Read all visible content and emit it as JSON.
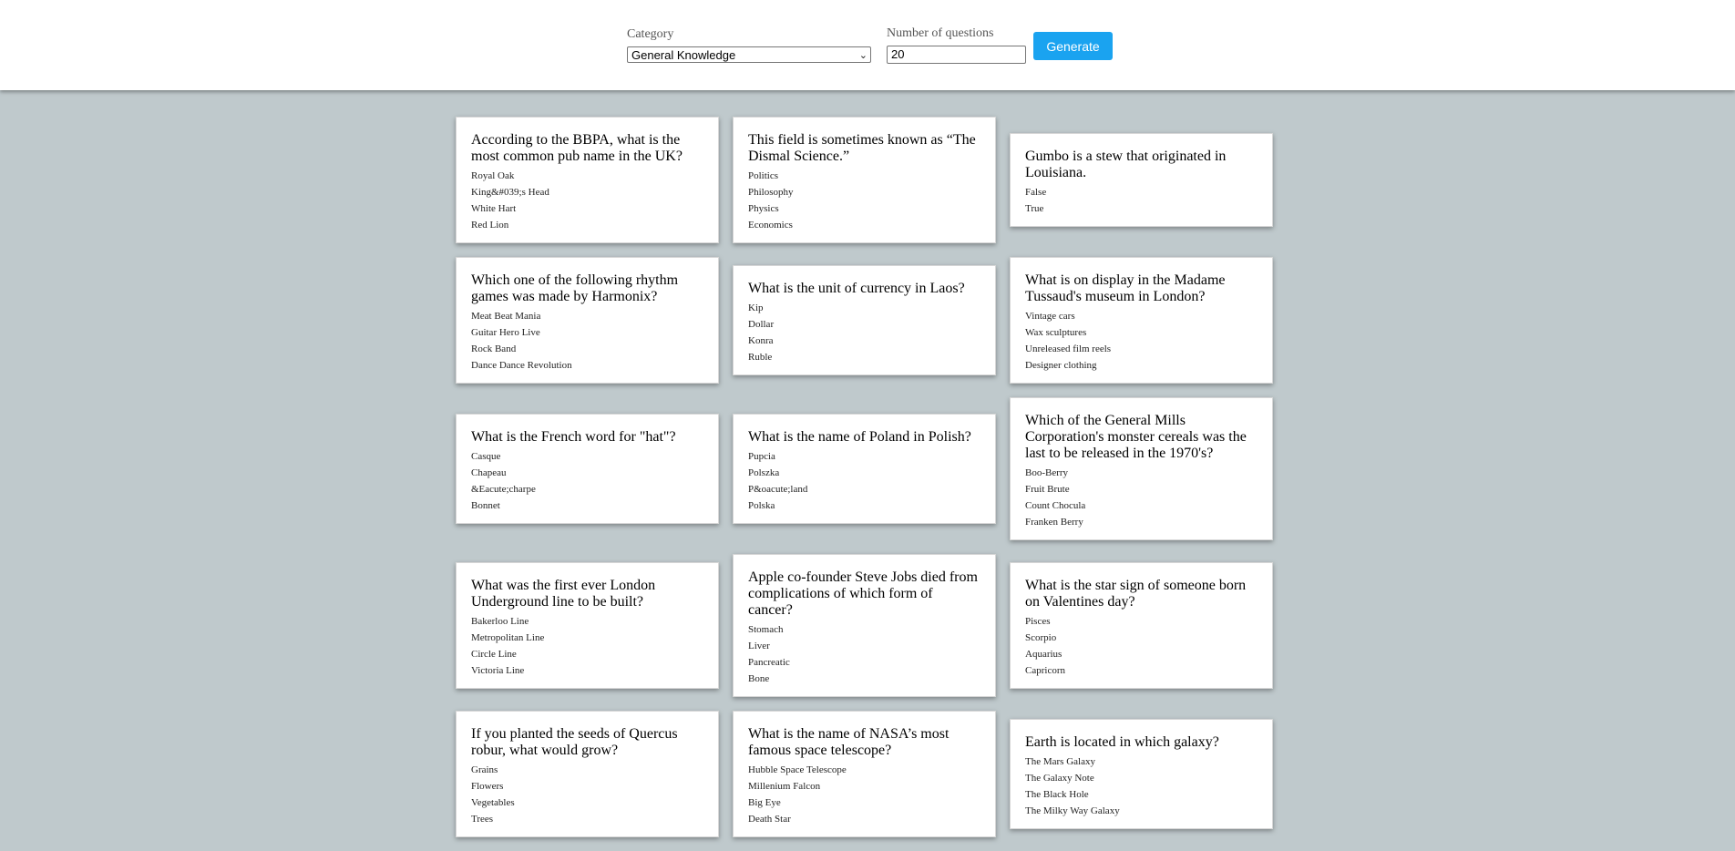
{
  "form": {
    "category_label": "Category",
    "category_value": "General Knowledge",
    "count_label": "Number of questions",
    "count_value": "20",
    "generate_label": "Generate"
  },
  "rows": [
    [
      {
        "question": "According to the BBPA, what is the most common pub name in the UK?",
        "answers": [
          "Royal Oak",
          "King&#039;s Head",
          "White Hart",
          "Red Lion"
        ]
      },
      {
        "question": "This field is sometimes known as “The Dismal Science.”",
        "answers": [
          "Politics",
          "Philosophy",
          "Physics",
          "Economics"
        ]
      },
      {
        "question": "Gumbo is a stew that originated in Louisiana.",
        "answers": [
          "False",
          "True"
        ]
      }
    ],
    [
      {
        "question": "Which one of the following rhythm games was made by Harmonix?",
        "answers": [
          "Meat Beat Mania",
          "Guitar Hero Live",
          "Rock Band",
          "Dance Dance Revolution"
        ]
      },
      {
        "question": "What is the unit of currency in Laos?",
        "answers": [
          "Kip",
          "Dollar",
          "Konra",
          "Ruble"
        ]
      },
      {
        "question": "What is on display in the Madame Tussaud's museum in London?",
        "answers": [
          "Vintage cars",
          "Wax sculptures",
          "Unreleased film reels",
          "Designer clothing"
        ]
      }
    ],
    [
      {
        "question": "What is the French word for \"hat\"?",
        "answers": [
          "Casque",
          "Chapeau",
          "&Eacute;charpe",
          "Bonnet"
        ]
      },
      {
        "question": "What is the name of Poland in Polish?",
        "answers": [
          "Pupcia",
          "Polszka",
          "P&oacute;land",
          "Polska"
        ]
      },
      {
        "question": "Which of the General Mills Corporation's monster cereals was the last to be released in the 1970's?",
        "answers": [
          "Boo-Berry",
          "Fruit Brute",
          "Count Chocula",
          "Franken Berry"
        ]
      }
    ],
    [
      {
        "question": "What was the first ever London Underground line to be built?",
        "answers": [
          "Bakerloo Line",
          "Metropolitan Line",
          "Circle Line",
          "Victoria Line"
        ]
      },
      {
        "question": "Apple co-founder Steve Jobs died from complications of which form of cancer?",
        "answers": [
          "Stomach",
          "Liver",
          "Pancreatic",
          "Bone"
        ]
      },
      {
        "question": "What is the star sign of someone born on Valentines day?",
        "answers": [
          "Pisces",
          "Scorpio",
          "Aquarius",
          "Capricorn"
        ]
      }
    ],
    [
      {
        "question": "If you planted the seeds of Quercus robur, what would grow?",
        "answers": [
          "Grains",
          "Flowers",
          "Vegetables",
          "Trees"
        ]
      },
      {
        "question": "What is the name of NASA’s most famous space telescope?",
        "answers": [
          "Hubble Space Telescope",
          "Millenium Falcon",
          "Big Eye",
          "Death Star"
        ]
      },
      {
        "question": "Earth is located in which galaxy?",
        "answers": [
          "The Mars Galaxy",
          "The Galaxy Note",
          "The Black Hole",
          "The Milky Way Galaxy"
        ]
      }
    ]
  ]
}
